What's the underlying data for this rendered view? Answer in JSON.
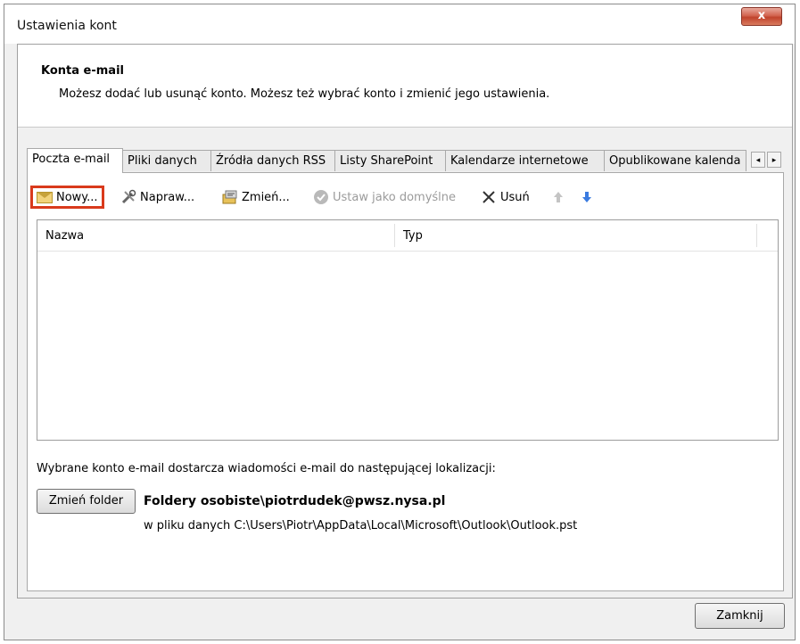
{
  "window": {
    "title": "Ustawienia kont",
    "close_glyph": "x"
  },
  "header": {
    "title": "Konta e-mail",
    "description": "Możesz dodać lub usunąć konto. Możesz też wybrać konto i zmienić jego ustawienia."
  },
  "tabs": [
    {
      "label": "Poczta e-mail",
      "active": true
    },
    {
      "label": "Pliki danych"
    },
    {
      "label": "Źródła danych RSS"
    },
    {
      "label": "Listy SharePoint"
    },
    {
      "label": "Kalendarze internetowe"
    },
    {
      "label": "Opublikowane kalenda"
    }
  ],
  "tab_scroll": {
    "left": "◂",
    "right": "▸"
  },
  "toolbar": {
    "new_label": "Nowy...",
    "repair_label": "Napraw...",
    "change_label": "Zmień...",
    "default_label": "Ustaw jako domyślne",
    "remove_label": "Usuń",
    "up_icon": "arrow-up-icon",
    "down_icon": "arrow-down-icon",
    "highlight_color": "#d93a1c"
  },
  "list": {
    "columns": [
      "Nazwa",
      "Typ"
    ],
    "rows": []
  },
  "delivery": {
    "description": "Wybrane konto e-mail dostarcza wiadomości e-mail do następującej lokalizacji:",
    "change_folder_label": "Zmień folder",
    "folder_name": "Foldery osobiste\\piotrdudek@pwsz.nysa.pl",
    "folder_path": "w pliku danych C:\\Users\\Piotr\\AppData\\Local\\Microsoft\\Outlook\\Outlook.pst"
  },
  "footer": {
    "close_label": "Zamknij"
  }
}
